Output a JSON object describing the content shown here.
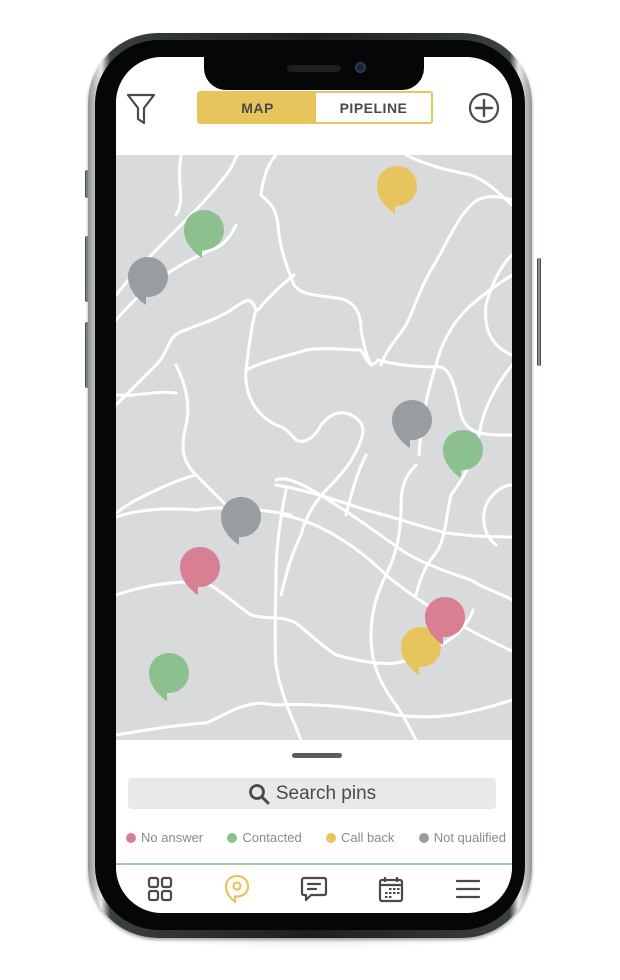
{
  "header": {
    "filter_icon": "filter-icon",
    "add_icon": "plus-circle-icon",
    "segments": [
      {
        "label": "MAP",
        "active": true
      },
      {
        "label": "PIPELINE",
        "active": false
      }
    ]
  },
  "colors": {
    "accent": "#e8c55c",
    "no_answer": "#d97f94",
    "contacted": "#8cc08f",
    "call_back": "#e8c55c",
    "not_qualified": "#979da1",
    "map_bg": "#d9dadc",
    "road": "#ffffff",
    "divider": "#9fcf9f"
  },
  "map": {
    "pins": [
      {
        "status": "call_back"
      },
      {
        "status": "contacted"
      },
      {
        "status": "not_qualified"
      },
      {
        "status": "not_qualified"
      },
      {
        "status": "contacted"
      },
      {
        "status": "not_qualified"
      },
      {
        "status": "no_answer"
      },
      {
        "status": "call_back"
      },
      {
        "status": "no_answer"
      },
      {
        "status": "contacted"
      }
    ]
  },
  "sheet": {
    "search_label": "Search pins",
    "search_icon": "search-icon",
    "legend": [
      {
        "label": "No answer",
        "status": "no_answer"
      },
      {
        "label": "Contacted",
        "status": "contacted"
      },
      {
        "label": "Call back",
        "status": "call_back"
      },
      {
        "label": "Not qualified",
        "status": "not_qualified"
      }
    ]
  },
  "nav": {
    "tabs": [
      {
        "name": "dashboard",
        "icon": "grid-icon",
        "active": false
      },
      {
        "name": "map",
        "icon": "map-pin-icon",
        "active": true
      },
      {
        "name": "messages",
        "icon": "chat-icon",
        "active": false
      },
      {
        "name": "calendar",
        "icon": "calendar-icon",
        "active": false
      },
      {
        "name": "menu",
        "icon": "hamburger-menu-icon",
        "active": false
      }
    ]
  }
}
